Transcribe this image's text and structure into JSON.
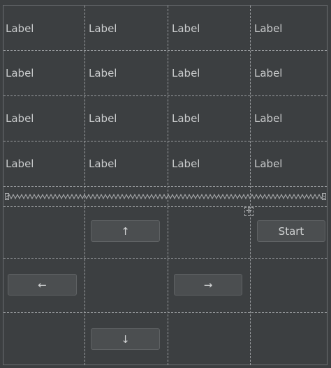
{
  "grid": {
    "rows": [
      [
        "Label",
        "Label",
        "Label",
        "Label"
      ],
      [
        "Label",
        "Label",
        "Label",
        "Label"
      ],
      [
        "Label",
        "Label",
        "Label",
        "Label"
      ],
      [
        "Label",
        "Label",
        "Label",
        "Label"
      ]
    ]
  },
  "controls": {
    "up_label": "↑",
    "left_label": "←",
    "right_label": "→",
    "down_label": "↓",
    "start_label": "Start"
  },
  "icons": {
    "splitter_handle": "resize-handle-icon",
    "move": "move-icon"
  },
  "colors": {
    "background": "#3c3f41",
    "button": "#4b4e50",
    "text": "#c9cbcc"
  }
}
